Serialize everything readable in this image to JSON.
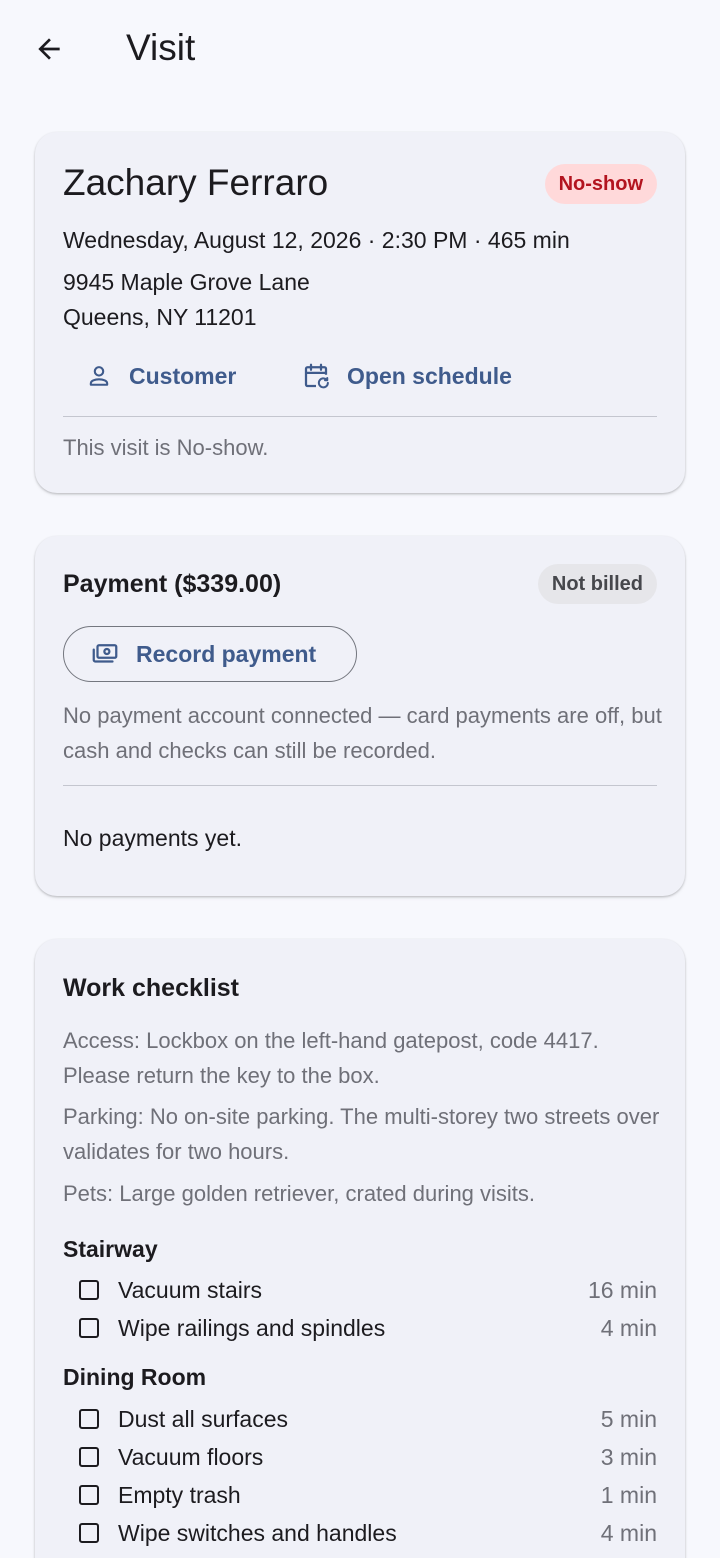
{
  "appbar": {
    "title": "Visit"
  },
  "visit": {
    "customer_name": "Zachary Ferraro",
    "status": "No-show",
    "when": "Wednesday, August 12, 2026 · 2:30 PM · 465 min",
    "address_line1": "9945 Maple Grove Lane",
    "address_line2": "Queens, NY 11201",
    "customer_link": "Customer",
    "schedule_link": "Open schedule",
    "note": "This visit is No-show."
  },
  "payment": {
    "title": "Payment ($339.00)",
    "billing_status": "Not billed",
    "record_button": "Record payment",
    "note": "No payment account connected — card payments are off, but cash and checks can still be recorded.",
    "empty_text": "No payments yet."
  },
  "checklist": {
    "title": "Work checklist",
    "notes": [
      "Access: Lockbox on the left-hand gatepost, code 4417. Please return the key to the box.",
      "Parking: No on-site parking. The multi-storey two streets over validates for two hours.",
      "Pets: Large golden retriever, crated during visits."
    ],
    "sections": [
      {
        "name": "Stairway",
        "tasks": [
          {
            "label": "Vacuum stairs",
            "duration": "16 min",
            "checked": false
          },
          {
            "label": "Wipe railings and spindles",
            "duration": "4 min",
            "checked": false
          }
        ]
      },
      {
        "name": "Dining Room",
        "tasks": [
          {
            "label": "Dust all surfaces",
            "duration": "5 min",
            "checked": false
          },
          {
            "label": "Vacuum floors",
            "duration": "3 min",
            "checked": false
          },
          {
            "label": "Empty trash",
            "duration": "1 min",
            "checked": false
          },
          {
            "label": "Wipe switches and handles",
            "duration": "4 min",
            "checked": false
          }
        ]
      }
    ]
  },
  "colors": {
    "background": "#f7f8fd",
    "card": "#f0f1f8",
    "accent": "#3f5b8c",
    "no_show_badge_bg": "#ffd9da",
    "no_show_badge_text": "#b3141f",
    "muted_text": "#6f7078"
  },
  "icons": {
    "back": "arrow-left-icon",
    "customer": "person-icon",
    "schedule": "calendar-refresh-icon",
    "payment": "cash-icon",
    "checkbox": "checkbox-outline-icon"
  }
}
